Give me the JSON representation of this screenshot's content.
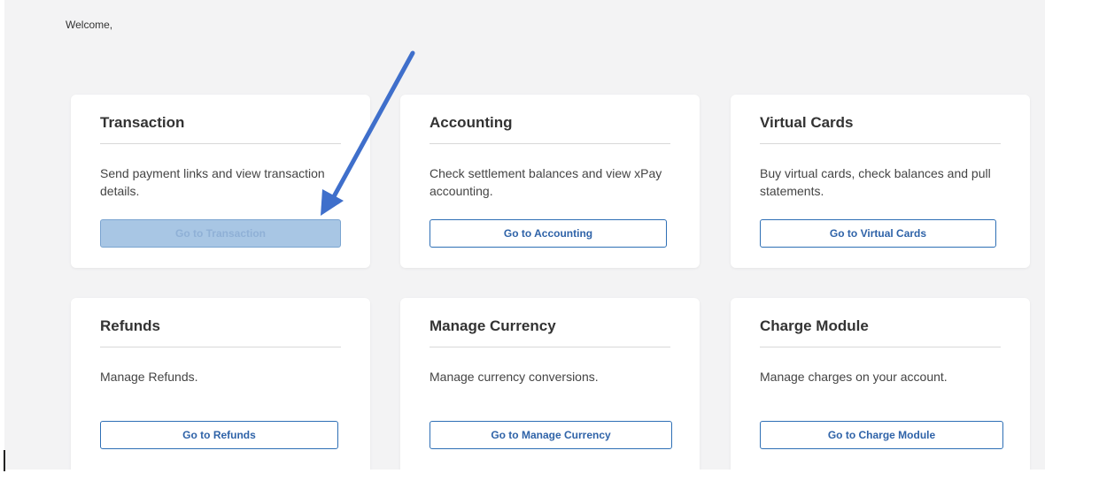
{
  "welcome_text": "Welcome,",
  "cards": [
    {
      "title": "Transaction",
      "description": "Send payment links and view transaction details.",
      "button": "Go to Transaction",
      "disabled": true
    },
    {
      "title": "Accounting",
      "description": "Check settlement balances and view xPay accounting.",
      "button": "Go to Accounting",
      "disabled": false
    },
    {
      "title": "Virtual Cards",
      "description": "Buy virtual cards, check balances and pull statements.",
      "button": "Go to Virtual Cards",
      "disabled": false
    },
    {
      "title": "Refunds",
      "description": "Manage Refunds.",
      "button": "Go to Refunds",
      "disabled": false
    },
    {
      "title": "Manage Currency",
      "description": "Manage currency conversions.",
      "button": "Go to Manage Currency",
      "disabled": false
    },
    {
      "title": "Charge Module",
      "description": "Manage charges on your account.",
      "button": "Go to Charge Module",
      "disabled": false
    }
  ],
  "colors": {
    "accent": "#2e6fb5",
    "annotation_arrow": "#3f6fcb",
    "background": "#f3f3f4"
  },
  "annotation": "arrow-pointing-to-transaction-button"
}
